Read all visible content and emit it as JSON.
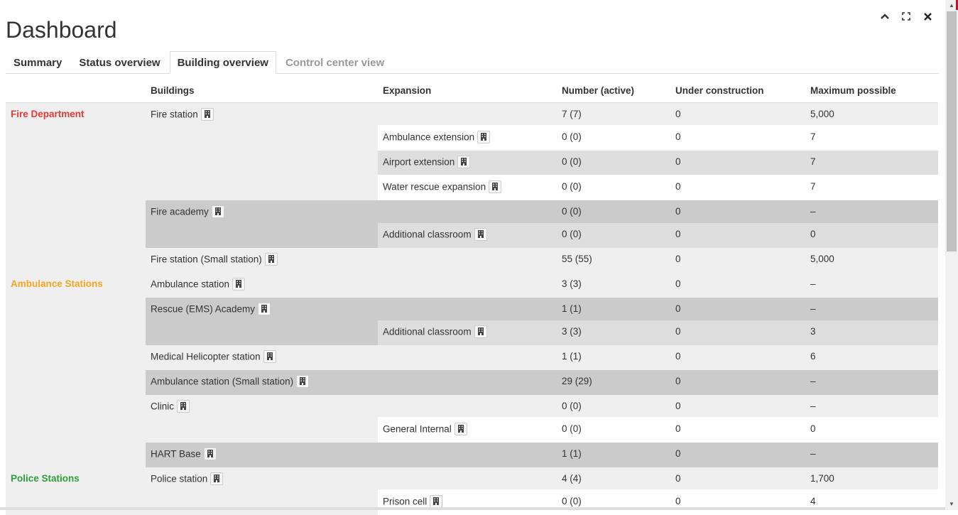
{
  "window": {
    "title": "Dashboard",
    "controls": [
      {
        "name": "minimize",
        "icon": "chevron-up-icon",
        "glyph": "⌃"
      },
      {
        "name": "fullscreen",
        "icon": "expand-icon",
        "glyph": "⛶"
      },
      {
        "name": "close",
        "icon": "close-icon",
        "glyph": "✕"
      }
    ]
  },
  "tabs": [
    {
      "label": "Summary",
      "state": "normal"
    },
    {
      "label": "Status overview",
      "state": "normal"
    },
    {
      "label": "Building overview",
      "state": "active"
    },
    {
      "label": "Control center view",
      "state": "disabled"
    }
  ],
  "table": {
    "headers": {
      "category": "",
      "buildings": "Buildings",
      "expansion": "Expansion",
      "number": "Number (active)",
      "construction": "Under construction",
      "maximum": "Maximum possible"
    },
    "categories": [
      {
        "label": "Fire Department",
        "color": "#e53935"
      },
      {
        "label": "Ambulance Stations",
        "color": "#f5a623"
      },
      {
        "label": "Police Stations",
        "color": "#2e9e3a"
      }
    ],
    "rows": [
      {
        "building": "Fire station",
        "expansion": "",
        "number": "7 (7)",
        "construction": "0",
        "maximum": "5,000"
      },
      {
        "building": "",
        "expansion": "Ambulance extension",
        "number": "0 (0)",
        "construction": "0",
        "maximum": "7"
      },
      {
        "building": "",
        "expansion": "Airport extension",
        "number": "0 (0)",
        "construction": "0",
        "maximum": "7"
      },
      {
        "building": "",
        "expansion": "Water rescue expansion",
        "number": "0 (0)",
        "construction": "0",
        "maximum": "7"
      },
      {
        "building": "Fire academy",
        "expansion": "",
        "number": "0 (0)",
        "construction": "0",
        "maximum": "–"
      },
      {
        "building": "",
        "expansion": "Additional classroom",
        "number": "0 (0)",
        "construction": "0",
        "maximum": "0"
      },
      {
        "building": "Fire station (Small station)",
        "expansion": "",
        "number": "55 (55)",
        "construction": "0",
        "maximum": "5,000"
      },
      {
        "building": "Ambulance station",
        "expansion": "",
        "number": "3 (3)",
        "construction": "0",
        "maximum": "–"
      },
      {
        "building": "Rescue (EMS) Academy",
        "expansion": "",
        "number": "1 (1)",
        "construction": "0",
        "maximum": "–"
      },
      {
        "building": "",
        "expansion": "Additional classroom",
        "number": "3 (3)",
        "construction": "0",
        "maximum": "3"
      },
      {
        "building": "Medical Helicopter station",
        "expansion": "",
        "number": "1 (1)",
        "construction": "0",
        "maximum": "6"
      },
      {
        "building": "Ambulance station (Small station)",
        "expansion": "",
        "number": "29 (29)",
        "construction": "0",
        "maximum": "–"
      },
      {
        "building": "Clinic",
        "expansion": "",
        "number": "0 (0)",
        "construction": "0",
        "maximum": "–"
      },
      {
        "building": "",
        "expansion": "General Internal",
        "number": "0 (0)",
        "construction": "0",
        "maximum": "0"
      },
      {
        "building": "HART Base",
        "expansion": "",
        "number": "1 (1)",
        "construction": "0",
        "maximum": "–"
      },
      {
        "building": "Police station",
        "expansion": "",
        "number": "4 (4)",
        "construction": "0",
        "maximum": "1,700"
      },
      {
        "building": "",
        "expansion": "Prison cell",
        "number": "0 (0)",
        "construction": "0",
        "maximum": "4"
      }
    ]
  }
}
